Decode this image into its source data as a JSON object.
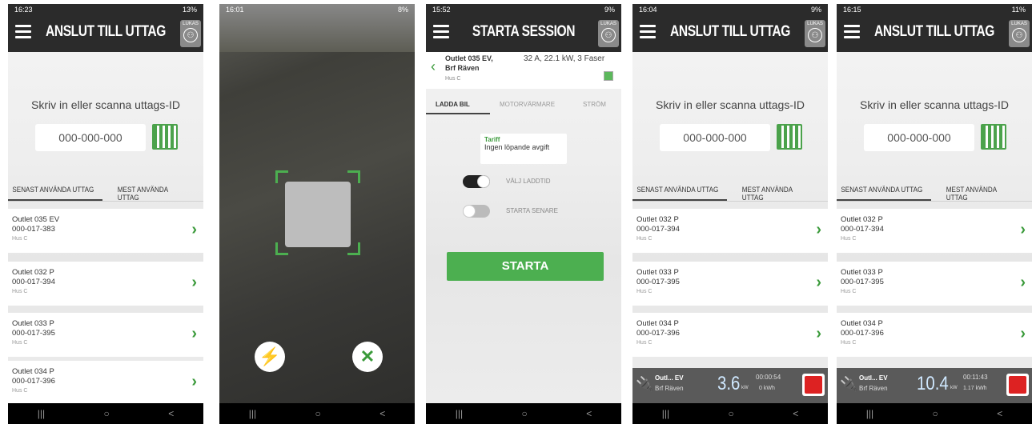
{
  "screens": [
    {
      "time": "16:23",
      "battery": "13%",
      "title": "ANSLUT TILL UTTAG",
      "user": "LUKAS",
      "prompt": "Skriv in eller scanna uttags-ID",
      "placeholder": "000-000-000",
      "tab1": "SENAST ANVÄNDA UTTAG",
      "tab2": "MEST ANVÄNDA UTTAG",
      "outlets": [
        {
          "name": "Outlet 035 EV",
          "id": "000-017-383",
          "loc": "Hus C"
        },
        {
          "name": "Outlet 032 P",
          "id": "000-017-394",
          "loc": "Hus C"
        },
        {
          "name": "Outlet 033 P",
          "id": "000-017-395",
          "loc": "Hus C"
        },
        {
          "name": "Outlet 034 P",
          "id": "000-017-396",
          "loc": "Hus C"
        }
      ]
    },
    {
      "time": "16:01",
      "battery": "8%"
    },
    {
      "time": "15:52",
      "battery": "9%",
      "title": "STARTA SESSION",
      "user": "LUKAS",
      "outlet_name": "Outlet 035 EV, Brf Räven",
      "location": "Hus C",
      "spec": "32 A, 22.1 kW, 3 Faser",
      "tab1": "LADDA BIL",
      "tab2": "MOTORVÄRMARE",
      "tab3": "STRÖM",
      "tariff_label": "Tariff",
      "tariff_text": "Ingen löpande avgift",
      "toggle1": "VÄLJ LADDTID",
      "toggle2": "STARTA SENARE",
      "start": "STARTA"
    },
    {
      "time": "16:04",
      "battery": "9%",
      "title": "ANSLUT TILL UTTAG",
      "user": "LUKAS",
      "prompt": "Skriv in eller scanna uttags-ID",
      "placeholder": "000-000-000",
      "tab1": "SENAST ANVÄNDA UTTAG",
      "tab2": "MEST ANVÄNDA UTTAG",
      "outlets": [
        {
          "name": "Outlet 032 P",
          "id": "000-017-394",
          "loc": "Hus C"
        },
        {
          "name": "Outlet 033 P",
          "id": "000-017-395",
          "loc": "Hus C"
        },
        {
          "name": "Outlet 034 P",
          "id": "000-017-396",
          "loc": "Hus C"
        }
      ],
      "charging": {
        "outlet": "Outl... EV",
        "place": "Brf Räven",
        "power": "3.6",
        "unit": "kW",
        "time": "00:00:54",
        "energy": "0 kWh"
      }
    },
    {
      "time": "16:15",
      "battery": "11%",
      "title": "ANSLUT TILL UTTAG",
      "user": "LUKAS",
      "prompt": "Skriv in eller scanna uttags-ID",
      "placeholder": "000-000-000",
      "tab1": "SENAST ANVÄNDA UTTAG",
      "tab2": "MEST ANVÄNDA UTTAG",
      "outlets": [
        {
          "name": "Outlet 032 P",
          "id": "000-017-394",
          "loc": "Hus C"
        },
        {
          "name": "Outlet 033 P",
          "id": "000-017-395",
          "loc": "Hus C"
        },
        {
          "name": "Outlet 034 P",
          "id": "000-017-396",
          "loc": "Hus C"
        }
      ],
      "charging": {
        "outlet": "Outl... EV",
        "place": "Brf Räven",
        "power": "10.4",
        "unit": "kW",
        "time": "00:11:43",
        "energy": "1.17 kWh"
      }
    }
  ],
  "nav": {
    "recent": "|||",
    "home": "○",
    "back": "<"
  }
}
